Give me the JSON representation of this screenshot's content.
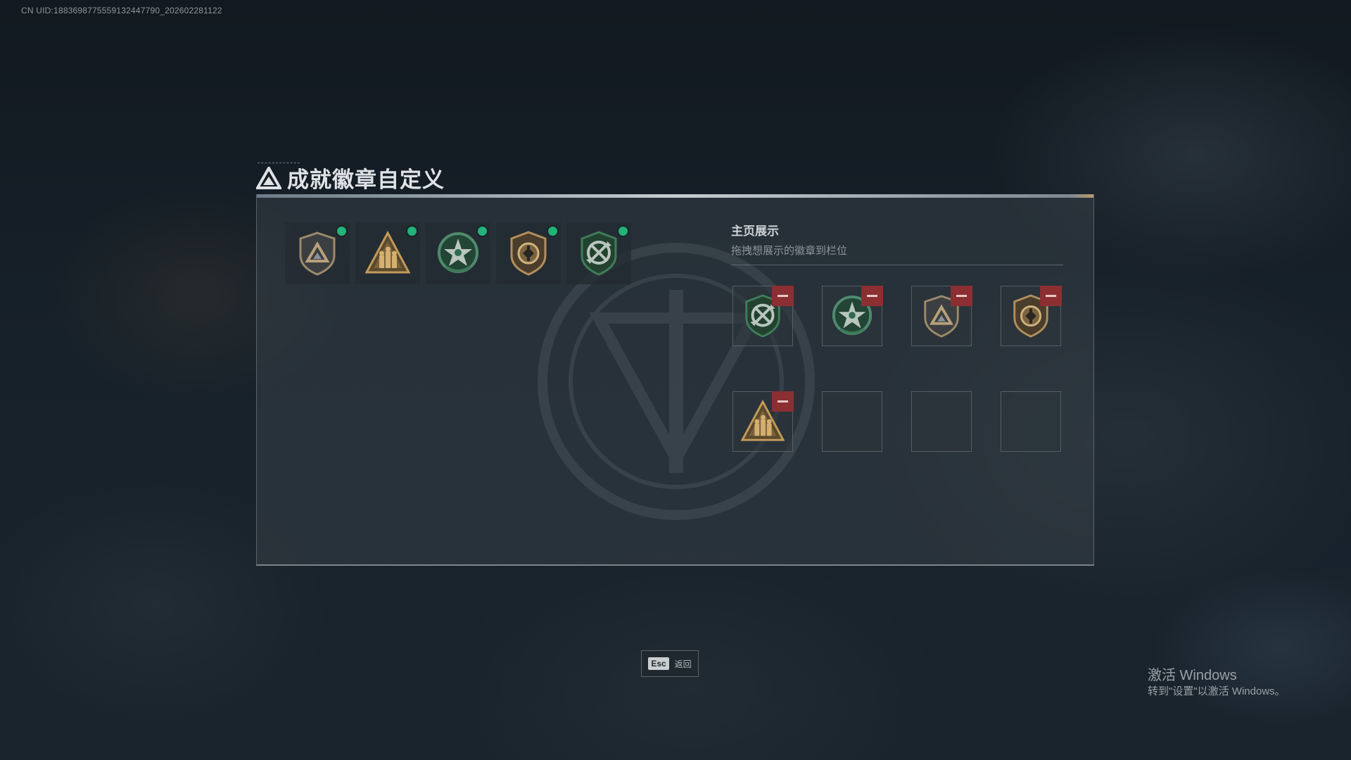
{
  "uid_text": "CN UID:1883698775559132447790_202602281122",
  "title": "成就徽章自定义",
  "badge_pool": [
    {
      "icon": "bronze-shield-triangle-badge-icon",
      "equipped": true
    },
    {
      "icon": "gold-triangle-soldiers-badge-icon",
      "equipped": true
    },
    {
      "icon": "green-star-wreath-badge-icon",
      "equipped": true
    },
    {
      "icon": "bronze-shield-emblem-badge-icon",
      "equipped": true
    },
    {
      "icon": "green-shield-arrows-badge-icon",
      "equipped": true
    }
  ],
  "showcase": {
    "title": "主页展示",
    "hint": "拖拽想展示的徽章到栏位",
    "slots": [
      {
        "icon": "green-shield-arrows-badge-icon",
        "filled": true
      },
      {
        "icon": "green-star-wreath-badge-icon",
        "filled": true
      },
      {
        "icon": "bronze-shield-triangle-badge-icon",
        "filled": true
      },
      {
        "icon": "bronze-shield-emblem-badge-icon",
        "filled": true
      },
      {
        "icon": "gold-triangle-soldiers-badge-icon",
        "filled": true
      },
      {
        "icon": "",
        "filled": false
      },
      {
        "icon": "",
        "filled": false
      },
      {
        "icon": "",
        "filled": false
      }
    ]
  },
  "esc": {
    "key": "Esc",
    "label": "返回"
  },
  "windows_watermark": {
    "title": "激活 Windows",
    "subtitle": "转到\"设置\"以激活 Windows。"
  },
  "colors": {
    "equipped_dot": "#22b27a",
    "remove_button": "#8b2f33",
    "panel_bg": "#363f47",
    "badge_green": "#2e6a4e",
    "badge_gold": "#a8884e"
  }
}
